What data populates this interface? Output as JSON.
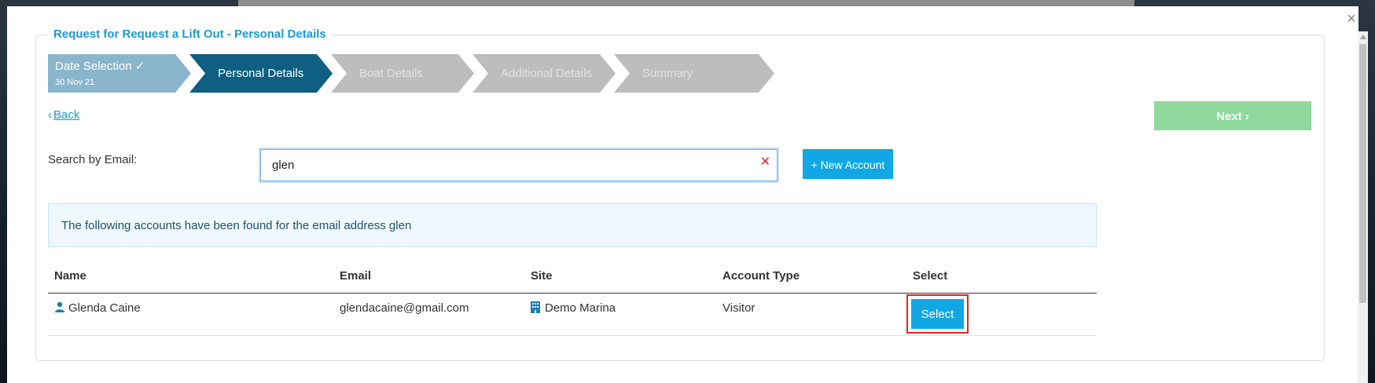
{
  "modal": {
    "close_glyph": "×",
    "legend": "Request for Request a Lift Out - Personal Details"
  },
  "wizard": {
    "steps": [
      {
        "label": "Date Selection",
        "sub": "30 Nov 21",
        "state": "completed",
        "check": "✓"
      },
      {
        "label": "Personal Details",
        "state": "active"
      },
      {
        "label": "Boat Details",
        "state": "inactive"
      },
      {
        "label": "Additional Details",
        "state": "inactive"
      },
      {
        "label": "Summary",
        "state": "inactive"
      }
    ]
  },
  "nav": {
    "back_chev": "‹",
    "back_label": "Back",
    "next_label": "Next",
    "next_chev": "›"
  },
  "search": {
    "label": "Search by Email:",
    "value": "glen",
    "clear_glyph": "✕",
    "new_account_label": "+ New Account"
  },
  "info": {
    "message": "The following accounts have been found for the email address glen"
  },
  "table": {
    "headers": [
      "Name",
      "Email",
      "Site",
      "Account Type",
      "Select"
    ],
    "rows": [
      {
        "name": "Glenda Caine",
        "email": "glendacaine@gmail.com",
        "site": "Demo Marina",
        "account_type": "Visitor",
        "select_label": "Select"
      }
    ]
  },
  "colors": {
    "accent": "#1a9ad6",
    "step_completed": "#8bb5cc",
    "step_active": "#0e5f82",
    "step_inactive": "#bdbdbd",
    "next_disabled": "#8fd99d",
    "highlight": "#d62828"
  }
}
